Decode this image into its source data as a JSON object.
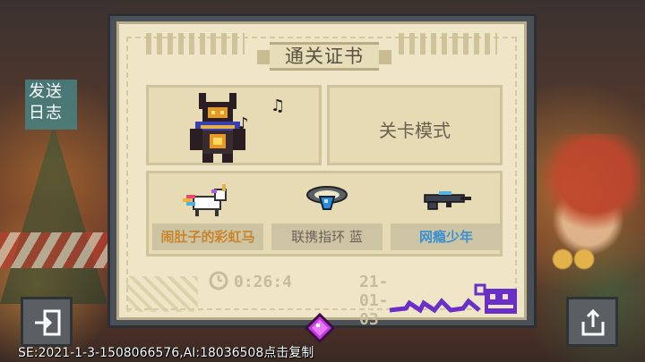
{
  "side_button": {
    "label_line1": "发送",
    "label_line2": "日志"
  },
  "certificate": {
    "title": "通关证书",
    "mode": "关卡模式",
    "items": [
      {
        "label": "闹肚子的彩虹马",
        "icon": "rainbow-unicorn-icon"
      },
      {
        "label": "联携指环 蓝",
        "icon": "blue-ring-icon"
      },
      {
        "label": "网瘾少年",
        "icon": "rifle-icon"
      }
    ],
    "time": "0:26:4",
    "date": "21-01-03"
  },
  "footer": {
    "seed_text": "SE:2021-1-3-1508066576,AI:18036508点击复制"
  },
  "colors": {
    "paper": "#efe6c7",
    "panel": "#e6dbb4",
    "label_orange": "#c9852b",
    "label_blue": "#3c8fd0",
    "signature_purple": "#6a2fc8"
  }
}
